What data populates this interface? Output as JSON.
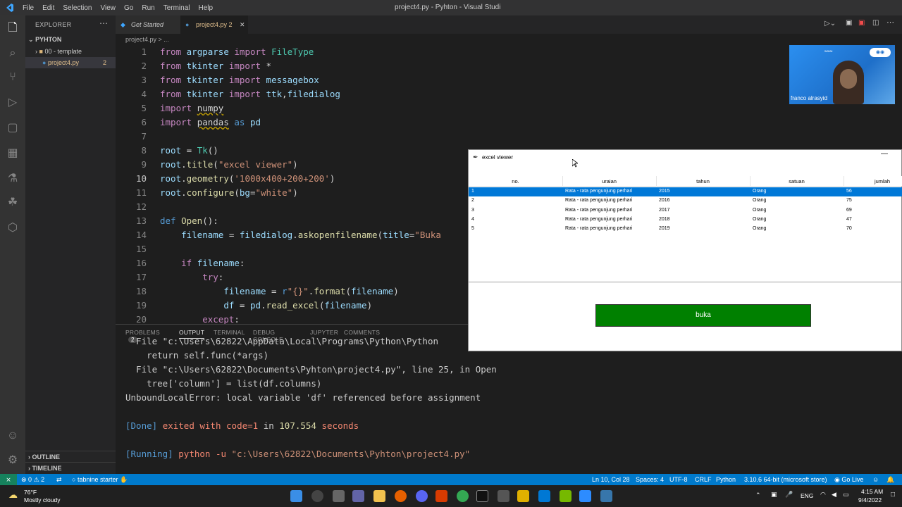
{
  "window": {
    "title": "project4.py - Pyhton - Visual Studi",
    "menu": [
      "File",
      "Edit",
      "Selection",
      "View",
      "Go",
      "Run",
      "Terminal",
      "Help"
    ]
  },
  "sidebar": {
    "header": "EXPLORER",
    "root": "PYHTON",
    "items": [
      {
        "label": "00 - template",
        "type": "folder"
      },
      {
        "label": "project4.py",
        "badge": "2",
        "type": "file"
      }
    ],
    "outline": "OUTLINE",
    "timeline": "TIMELINE"
  },
  "tabs": [
    {
      "label": "Get Started",
      "active": false
    },
    {
      "label": "project4.py",
      "badge": "2",
      "active": true
    }
  ],
  "breadcrumb": "project4.py > ...",
  "editor": {
    "current_line": 10,
    "lines": [
      {
        "n": "1",
        "text": "from argparse import FileType"
      },
      {
        "n": "2",
        "text": "from tkinter import *"
      },
      {
        "n": "3",
        "text": "from tkinter import messagebox"
      },
      {
        "n": "4",
        "text": "from tkinter import ttk,filedialog"
      },
      {
        "n": "5",
        "text": "import numpy"
      },
      {
        "n": "6",
        "text": "import pandas as pd"
      },
      {
        "n": "7",
        "text": ""
      },
      {
        "n": "8",
        "text": "root = Tk()"
      },
      {
        "n": "9",
        "text": "root.title(\"excel viewer\")"
      },
      {
        "n": "10",
        "text": "root.geometry('1000x400+200+200')"
      },
      {
        "n": "11",
        "text": "root.configure(bg=\"white\")"
      },
      {
        "n": "12",
        "text": ""
      },
      {
        "n": "13",
        "text": "def Open():"
      },
      {
        "n": "14",
        "text": "    filename = filedialog.askopenfilename(title=\"Buka"
      },
      {
        "n": "15",
        "text": ""
      },
      {
        "n": "16",
        "text": "    if filename:"
      },
      {
        "n": "17",
        "text": "        try:"
      },
      {
        "n": "18",
        "text": "            filename = r\"{}\".format(filename)"
      },
      {
        "n": "19",
        "text": "            df = pd.read_excel(filename)"
      },
      {
        "n": "20",
        "text": "        except:"
      }
    ]
  },
  "panel": {
    "tabs": [
      "PROBLEMS",
      "OUTPUT",
      "TERMINAL",
      "DEBUG CONSOLE",
      "JUPYTER",
      "COMMENTS"
    ],
    "problems_count": "2",
    "active_tab": "OUTPUT",
    "output": [
      "  File \"c:\\Users\\62822\\AppData\\Local\\Programs\\Python\\Python",
      "    return self.func(*args)",
      "  File \"c:\\Users\\62822\\Documents\\Pyhton\\project4.py\", line 25, in Open",
      "    tree['column'] = list(df.columns)",
      "UnboundLocalError: local variable 'df' referenced before assignment",
      "",
      "[Done] exited with code=1 in 107.554 seconds",
      "",
      "[Running] python -u \"c:\\Users\\62822\\Documents\\Pyhton\\project4.py\""
    ]
  },
  "statusbar": {
    "errors": "0",
    "warnings": "2",
    "tabnine": "tabnine starter",
    "position": "Ln 10, Col 28",
    "spaces": "Spaces: 4",
    "encoding": "UTF-8",
    "eol": "CRLF",
    "language": "Python",
    "interpreter": "3.10.6 64-bit (microsoft store)",
    "golive": "Go Live"
  },
  "taskbar": {
    "weather_temp": "76°F",
    "weather_desc": "Mostly cloudy",
    "lang": "ENG",
    "time": "4:15 AM",
    "date": "9/4/2022"
  },
  "excel_viewer": {
    "title": "excel viewer",
    "columns": [
      "no.",
      "uraian",
      "tahun",
      "satuan",
      "jumlah"
    ],
    "rows": [
      [
        "1",
        "Rata - rata pengunjung perhari",
        "2015",
        "Orang",
        "56"
      ],
      [
        "2",
        "Rata - rata pengunjung perhari",
        "2016",
        "Orang",
        "75"
      ],
      [
        "3",
        "Rata - rata pengunjung perhari",
        "2017",
        "Orang",
        "69"
      ],
      [
        "4",
        "Rata - rata pengunjung perhari",
        "2018",
        "Orang",
        "47"
      ],
      [
        "5",
        "Rata - rata pengunjung perhari",
        "2019",
        "Orang",
        "70"
      ]
    ],
    "selected_row": 0,
    "button_label": "buka",
    "button_color": "#008000"
  },
  "video_overlay": {
    "name": "franco alrasyid"
  }
}
